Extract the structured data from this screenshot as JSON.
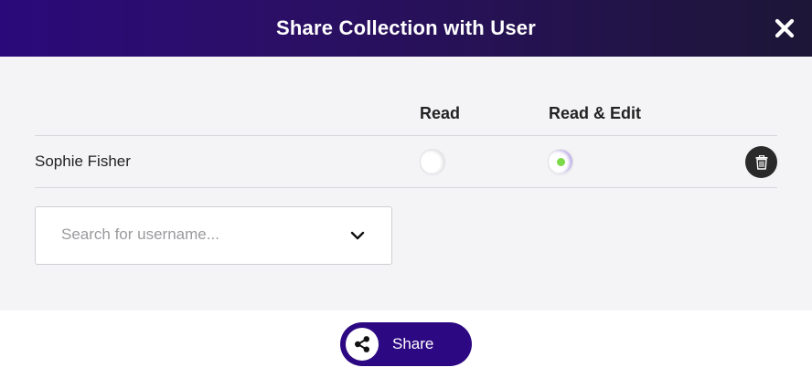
{
  "dialog": {
    "title": "Share Collection with User"
  },
  "columns": {
    "read": "Read",
    "read_edit": "Read & Edit"
  },
  "users": [
    {
      "name": "Sophie Fisher",
      "permission": "Read & Edit"
    }
  ],
  "search": {
    "placeholder": "Search for username..."
  },
  "footer": {
    "share_label": "Share"
  },
  "colors": {
    "header_start": "#2a0a7a",
    "header_end": "#1d1637",
    "share_button": "#2d0883",
    "selected_dot": "#7cd94a"
  }
}
